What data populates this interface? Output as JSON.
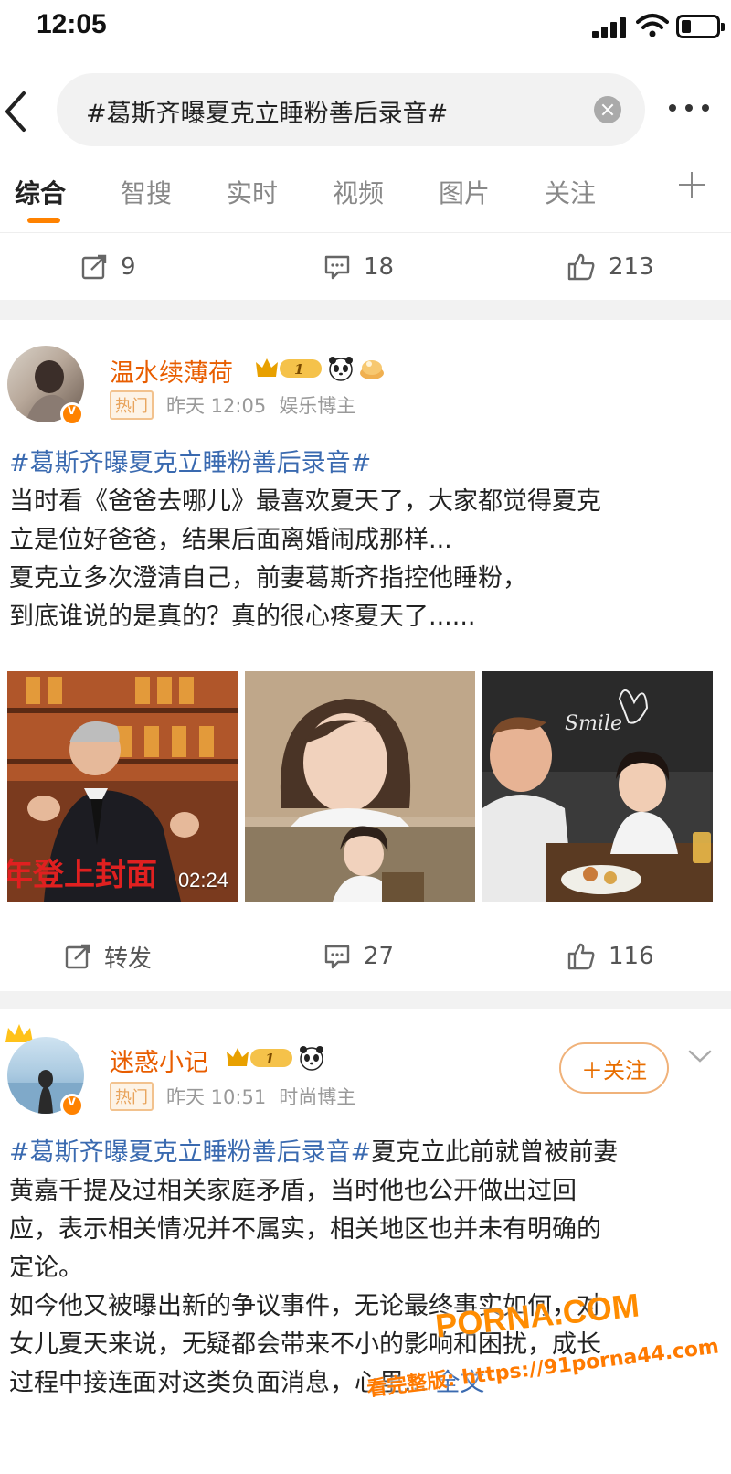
{
  "status_bar": {
    "time": "12:05"
  },
  "search": {
    "query": "#葛斯齐曝夏克立睡粉善后录音#"
  },
  "tabs": [
    {
      "label": "综合"
    },
    {
      "label": "智搜"
    },
    {
      "label": "实时"
    },
    {
      "label": "视频"
    },
    {
      "label": "图片"
    },
    {
      "label": "关注"
    }
  ],
  "prev_post": {
    "actions": {
      "repost": "9",
      "comments": "18",
      "likes": "213"
    }
  },
  "posts": [
    {
      "user": "温水续薄荷",
      "vip_level": "1",
      "tag": "热门",
      "time": "昨天 12:05",
      "role": "娱乐博主",
      "hashtag": "#葛斯齐曝夏克立睡粉善后录音#",
      "lines": [
        "当时看《爸爸去哪儿》最喜欢夏天了，大家都觉得夏克",
        "立是位好爸爸，结果后面离婚闹成那样...",
        "夏克立多次澄清自己，前妻葛斯齐指控他睡粉，",
        "到底谁说的是真的？真的很心疼夏天了......"
      ],
      "video": {
        "duration": "02:24",
        "caption": "年登上封面"
      },
      "actions": {
        "repost": "转发",
        "comments": "27",
        "likes": "116"
      }
    },
    {
      "user": "迷惑小记",
      "vip_level": "1",
      "tag": "热门",
      "time": "昨天 10:51",
      "role": "时尚博主",
      "follow_label": "＋关注",
      "hashtag": "#葛斯齐曝夏克立睡粉善后录音#",
      "first_line_rest": "夏克立此前就曾被前妻",
      "lines": [
        "黄嘉千提及过相关家庭矛盾，当时他也公开做出过回",
        "应，表示相关情况并不属实，相关地区也并未有明确的",
        "定论。",
        "如今他又被曝出新的争议事件，无论最终事实如何，对",
        "女儿夏天来说，无疑都会带来不小的影响和困扰，成长"
      ],
      "last_line": "过程中接连面对这类负面消息，心里...",
      "read_more": "全文"
    }
  ],
  "watermark": {
    "brand": "PORNA.COM",
    "url": "看完整版: https://91porna44.com"
  },
  "colors": {
    "accent": "#ff8200",
    "username": "#e85d00",
    "hashtag": "#3a6ab0"
  }
}
